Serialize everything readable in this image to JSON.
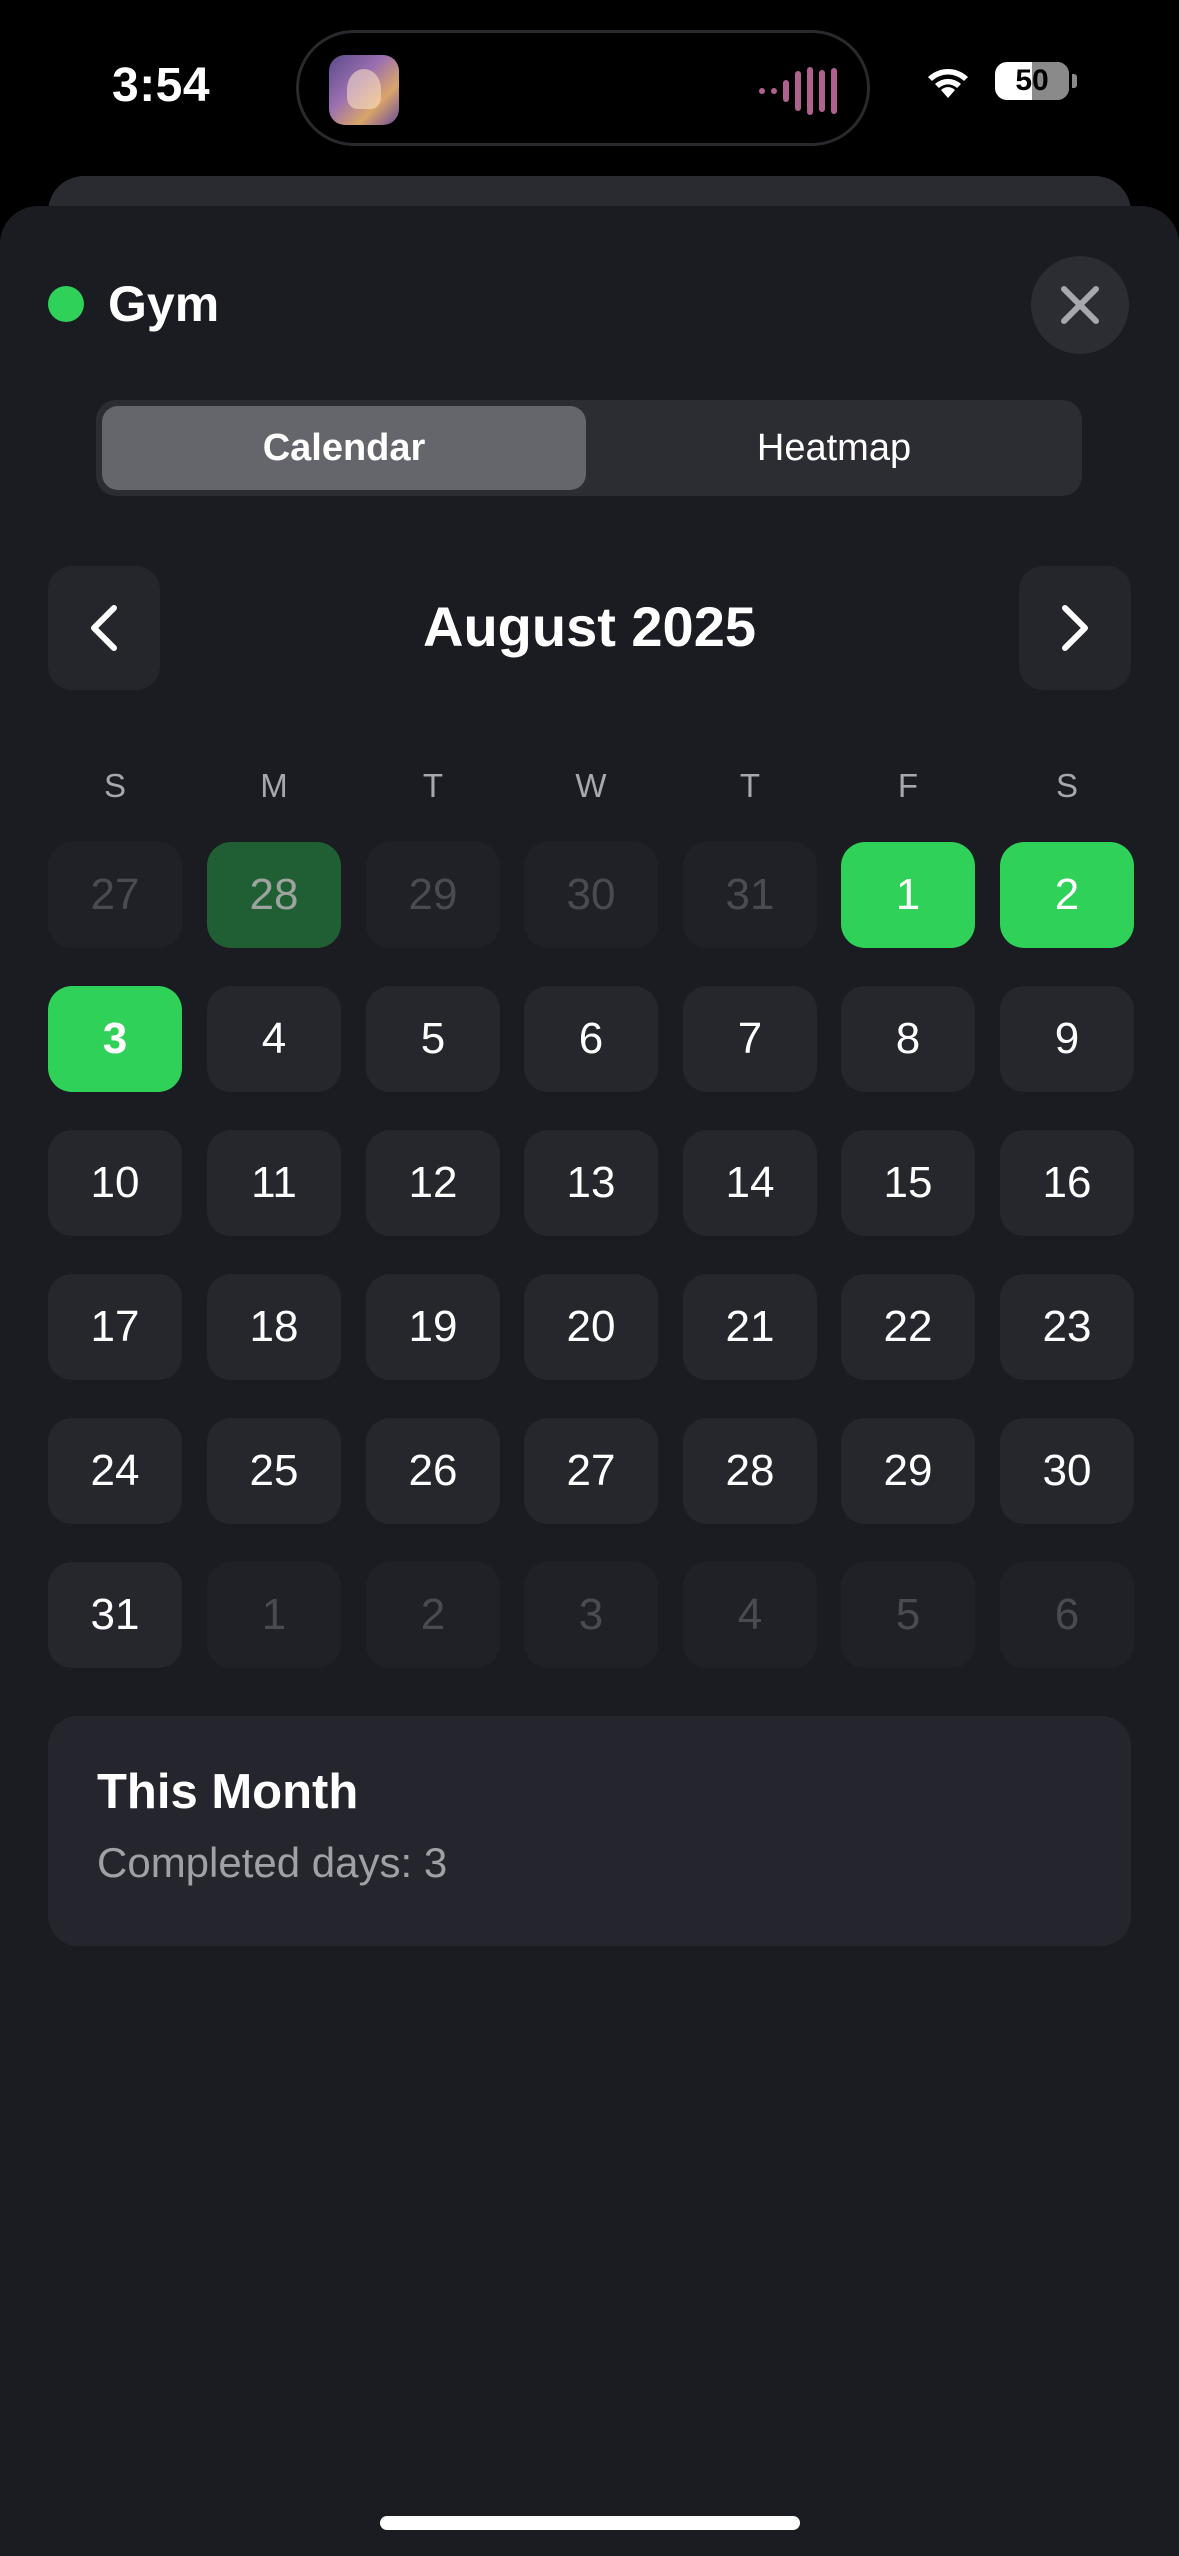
{
  "status_bar": {
    "time": "3:54",
    "battery": "50",
    "battery_level": 0.5
  },
  "habit": {
    "name": "Gym",
    "color": "#30d158"
  },
  "tabs": [
    {
      "label": "Calendar",
      "active": true
    },
    {
      "label": "Heatmap",
      "active": false
    }
  ],
  "calendar": {
    "month_title": "August 2025",
    "weekdays": [
      "S",
      "M",
      "T",
      "W",
      "T",
      "F",
      "S"
    ],
    "weeks": [
      [
        {
          "label": "27",
          "other": true,
          "done": false
        },
        {
          "label": "28",
          "other": true,
          "done": true
        },
        {
          "label": "29",
          "other": true,
          "done": false
        },
        {
          "label": "30",
          "other": true,
          "done": false
        },
        {
          "label": "31",
          "other": true,
          "done": false
        },
        {
          "label": "1",
          "other": false,
          "done": true
        },
        {
          "label": "2",
          "other": false,
          "done": true
        }
      ],
      [
        {
          "label": "3",
          "other": false,
          "done": true,
          "today": true
        },
        {
          "label": "4",
          "other": false,
          "done": false
        },
        {
          "label": "5",
          "other": false,
          "done": false
        },
        {
          "label": "6",
          "other": false,
          "done": false
        },
        {
          "label": "7",
          "other": false,
          "done": false
        },
        {
          "label": "8",
          "other": false,
          "done": false
        },
        {
          "label": "9",
          "other": false,
          "done": false
        }
      ],
      [
        {
          "label": "10",
          "other": false,
          "done": false
        },
        {
          "label": "11",
          "other": false,
          "done": false
        },
        {
          "label": "12",
          "other": false,
          "done": false
        },
        {
          "label": "13",
          "other": false,
          "done": false
        },
        {
          "label": "14",
          "other": false,
          "done": false
        },
        {
          "label": "15",
          "other": false,
          "done": false
        },
        {
          "label": "16",
          "other": false,
          "done": false
        }
      ],
      [
        {
          "label": "17",
          "other": false,
          "done": false
        },
        {
          "label": "18",
          "other": false,
          "done": false
        },
        {
          "label": "19",
          "other": false,
          "done": false
        },
        {
          "label": "20",
          "other": false,
          "done": false
        },
        {
          "label": "21",
          "other": false,
          "done": false
        },
        {
          "label": "22",
          "other": false,
          "done": false
        },
        {
          "label": "23",
          "other": false,
          "done": false
        }
      ],
      [
        {
          "label": "24",
          "other": false,
          "done": false
        },
        {
          "label": "25",
          "other": false,
          "done": false
        },
        {
          "label": "26",
          "other": false,
          "done": false
        },
        {
          "label": "27",
          "other": false,
          "done": false
        },
        {
          "label": "28",
          "other": false,
          "done": false
        },
        {
          "label": "29",
          "other": false,
          "done": false
        },
        {
          "label": "30",
          "other": false,
          "done": false
        }
      ],
      [
        {
          "label": "31",
          "other": false,
          "done": false
        },
        {
          "label": "1",
          "other": true,
          "done": false
        },
        {
          "label": "2",
          "other": true,
          "done": false
        },
        {
          "label": "3",
          "other": true,
          "done": false
        },
        {
          "label": "4",
          "other": true,
          "done": false
        },
        {
          "label": "5",
          "other": true,
          "done": false
        },
        {
          "label": "6",
          "other": true,
          "done": false
        }
      ]
    ]
  },
  "summary": {
    "title": "This Month",
    "completed_text": "Completed days: 3"
  },
  "colors": {
    "background": "#1b1c21",
    "completed": "#30d158",
    "completed_other_month": "#1f5f33",
    "cell": "#26272d"
  }
}
